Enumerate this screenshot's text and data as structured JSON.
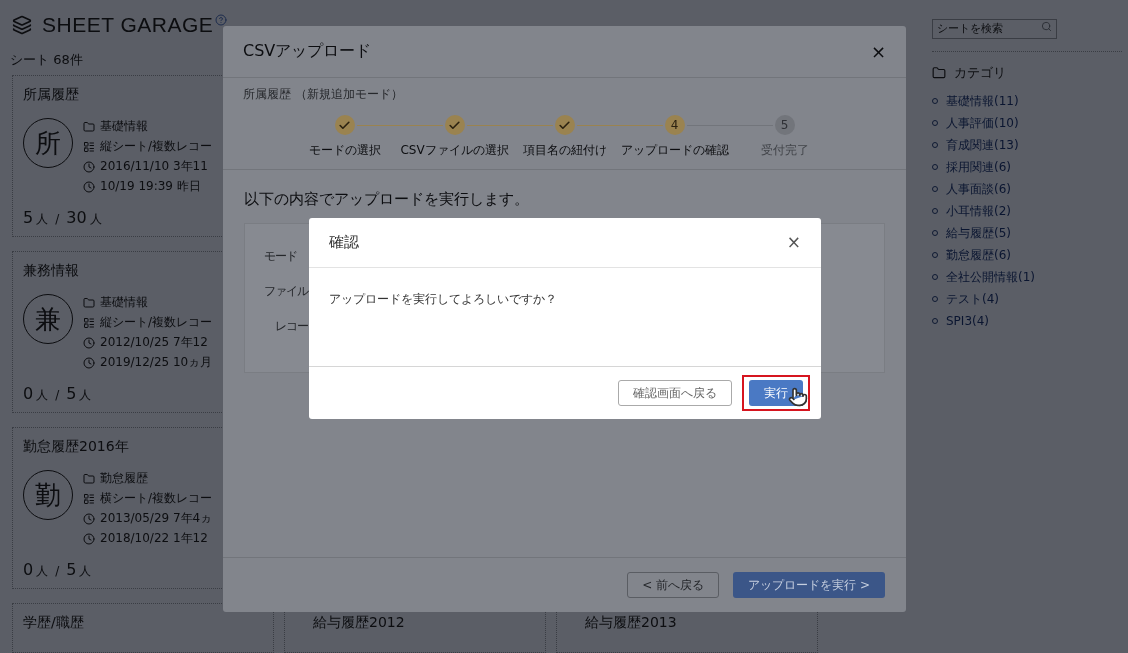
{
  "app": {
    "title": "SHEET GARAGE",
    "sheet_count": "シート 68件"
  },
  "cards": [
    {
      "title": "所属履歴",
      "initial": "所",
      "category": "基礎情報",
      "type": "縦シート/複数レコー",
      "created": "2016/11/10 3年11",
      "updated": "10/19 19:39 昨日",
      "current": "5",
      "current_unit": "人",
      "separator": "/",
      "total": "30",
      "total_unit": "人"
    },
    {
      "title": "兼務情報",
      "initial": "兼",
      "category": "基礎情報",
      "type": "縦シート/複数レコー",
      "created": "2012/10/25 7年12",
      "updated": "2019/12/25 10ヵ月",
      "current": "0",
      "current_unit": "人",
      "separator": "/",
      "total": "5",
      "total_unit": "人"
    },
    {
      "title": "勤怠履歴2016年",
      "initial": "勤",
      "category": "勤怠履歴",
      "type": "横シート/複数レコー",
      "created": "2013/05/29 7年4ヵ",
      "updated": "2018/10/22 1年12",
      "current": "0",
      "current_unit": "人",
      "separator": "/",
      "total": "5",
      "total_unit": "人"
    }
  ],
  "bottom_row": [
    "学歴/職歴",
    "給与履歴2012",
    "給与履歴2013"
  ],
  "sidebar": {
    "search": {
      "placeholder": "シートを検索"
    },
    "heading": "カテゴリ",
    "categories": [
      "基礎情報(11)",
      "人事評価(10)",
      "育成関連(13)",
      "採用関連(6)",
      "人事面談(6)",
      "小耳情報(2)",
      "給与履歴(5)",
      "勤怠履歴(6)",
      "全社公開情報(1)",
      "テスト(4)",
      "SPI3(4)"
    ]
  },
  "upload_modal": {
    "title": "CSVアップロード",
    "close": "×",
    "subtitle": "所属履歴 （新規追加モード）",
    "steps": [
      {
        "label": "モードの選択",
        "done": true,
        "current": false
      },
      {
        "label": "CSVファイルの選択",
        "done": true,
        "current": false
      },
      {
        "label": "項目名の紐付け",
        "done": true,
        "current": false
      },
      {
        "number": "4",
        "label": "アップロードの確認",
        "done": false,
        "current": true
      },
      {
        "number": "5",
        "label": "受付完了",
        "done": false,
        "current": false
      }
    ],
    "heading": "以下の内容でアップロードを実行します。",
    "summary_labels": [
      "モード",
      "ファイル",
      "レコー"
    ],
    "back_button": "< 前へ戻る",
    "submit_button": "アップロードを実行 >"
  },
  "confirm_dialog": {
    "title": "確認",
    "close": "×",
    "message": "アップロードを実行してよろしいですか？",
    "cancel_button": "確認画面へ戻る",
    "ok_button": "実行",
    "ok_highlighted": true
  }
}
